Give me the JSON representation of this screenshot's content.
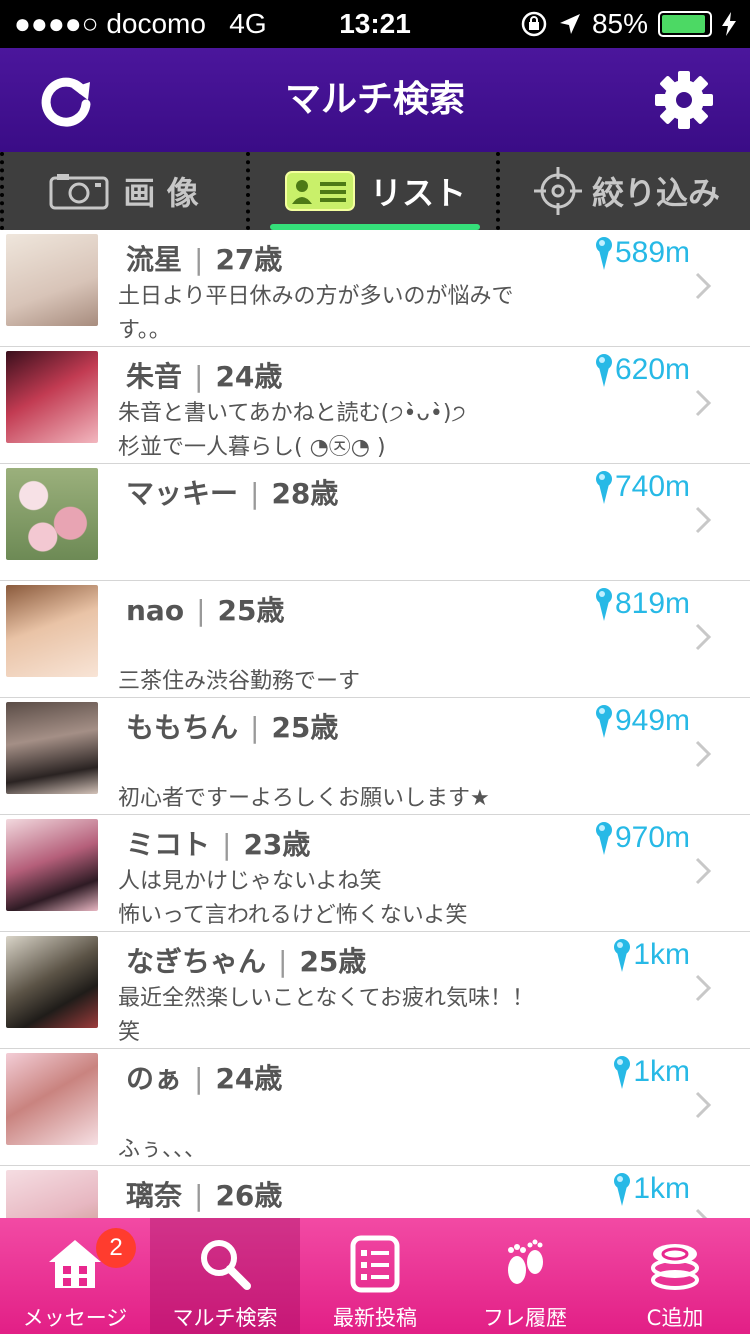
{
  "status": {
    "carrier": "●●●●○ docomo",
    "network": "4G",
    "time": "13:21",
    "battery": "85%"
  },
  "header": {
    "title": "マルチ検索"
  },
  "segments": [
    {
      "label": "画 像"
    },
    {
      "label": "リスト"
    },
    {
      "label": "絞り込み"
    }
  ],
  "users": [
    {
      "name": "流星",
      "age": "27歳",
      "distance": "589m",
      "message": "土日より平日休みの方が多いのが悩みで\nす。。"
    },
    {
      "name": "朱音",
      "age": "24歳",
      "distance": "620m",
      "message": "朱音と書いてあかねと読む(੭•̀ᴗ•̀)੭\n杉並で一人暮らし( ◔㉨◔ )"
    },
    {
      "name": "マッキー",
      "age": "28歳",
      "distance": "740m",
      "message": ""
    },
    {
      "name": "nao",
      "age": "25歳",
      "distance": "819m",
      "message": "\n三茶住み渋谷勤務でーす"
    },
    {
      "name": "ももちん",
      "age": "25歳",
      "distance": "949m",
      "message": "\n初心者ですーよろしくお願いします★"
    },
    {
      "name": "ミコト",
      "age": "23歳",
      "distance": "970m",
      "message": "人は見かけじゃないよね笑\n怖いって言われるけど怖くないよ笑"
    },
    {
      "name": "なぎちゃん",
      "age": "25歳",
      "distance": "1km",
      "message": "最近全然楽しいことなくてお疲れ気味！！\n笑"
    },
    {
      "name": "のぁ",
      "age": "24歳",
      "distance": "1km",
      "message": "\nふぅ、、、"
    },
    {
      "name": "璃奈",
      "age": "26歳",
      "distance": "1km",
      "message": ""
    }
  ],
  "tabs": [
    {
      "label": "メッセージ",
      "badge": "2"
    },
    {
      "label": "マルチ検索"
    },
    {
      "label": "最新投稿"
    },
    {
      "label": "フレ履歴"
    },
    {
      "label": "C追加"
    }
  ],
  "colors": {
    "header": "#3f0f8c",
    "tabbar": "#e8288e",
    "distance": "#27b9e6",
    "segment_accent": "#35e07a"
  }
}
